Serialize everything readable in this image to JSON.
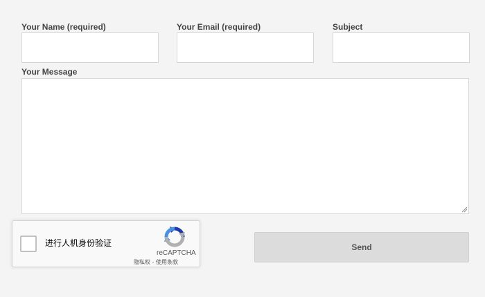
{
  "form": {
    "name_label": "Your Name (required)",
    "email_label": "Your Email (required)",
    "subject_label": "Subject",
    "message_label": "Your Message",
    "name_value": "",
    "email_value": "",
    "subject_value": "",
    "message_value": "",
    "send_label": "Send"
  },
  "recaptcha": {
    "checkbox_label": "进行人机身份验证",
    "brand": "reCAPTCHA",
    "privacy_link": "隐私权",
    "separator": " - ",
    "terms_link": "使用条款",
    "checked": false
  },
  "icons": {
    "recaptcha_logo": "recaptcha-logo-icon",
    "resize_grip": "resize-grip-icon"
  },
  "colors": {
    "background": "#f4f4f4",
    "field_border": "#d6d6d6",
    "label_text": "#444444",
    "button_bg": "#dcdcdc",
    "button_text": "#555555",
    "recaptcha_blue_dark": "#1c3aa9",
    "recaptcha_blue_light": "#4a90e2",
    "recaptcha_gray": "#b0b0b0"
  }
}
